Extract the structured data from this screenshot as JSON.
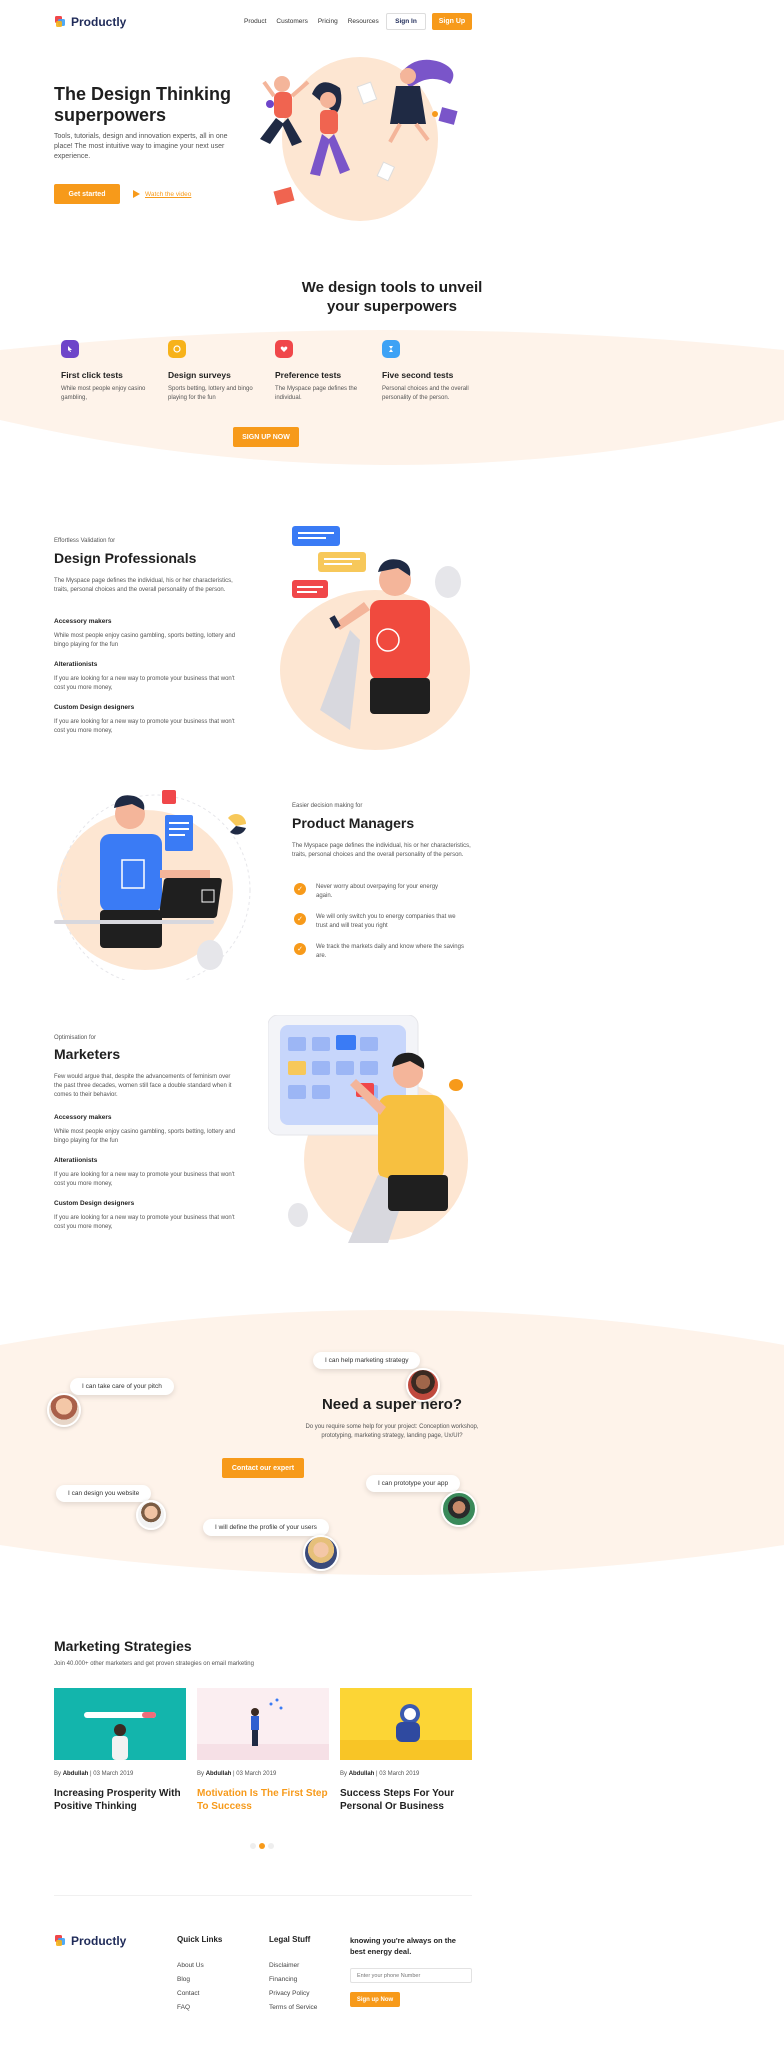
{
  "nav": {
    "brand": "Productly",
    "links": [
      "Product",
      "Customers",
      "Pricing",
      "Resources"
    ],
    "signin": "Sign In",
    "signup": "Sign Up"
  },
  "hero": {
    "title_line1": "The Design Thinking",
    "title_line2": "superpowers",
    "desc": "Tools, tutorials, design and innovation experts, all in one place! The most intuitive way to imagine your next user experience.",
    "cta": "Get started",
    "video": "Watch the video"
  },
  "tools": {
    "title_line1": "We design tools to unveil",
    "title_line2": "your superpowers",
    "features": [
      {
        "title": "First click tests",
        "desc": "While most people enjoy casino gambling,",
        "color": "#6e45c9"
      },
      {
        "title": "Design surveys",
        "desc": "Sports betting, lottery and bingo playing for the fun",
        "color": "#f7b21a"
      },
      {
        "title": "Preference tests",
        "desc": "The Myspace page defines the individual.",
        "color": "#f0474a"
      },
      {
        "title": "Five second tests",
        "desc": "Personal choices and the overall personality of the person.",
        "color": "#3ea2f5"
      }
    ],
    "cta": "SIGN UP NOW"
  },
  "designers": {
    "eyebrow": "Effortless Validation for",
    "title": "Design Professionals",
    "desc": "The Myspace page defines the individual, his or her characteristics, traits, personal choices and the overall personality of the person.",
    "items": [
      {
        "title": "Accessory makers",
        "desc": "While most people enjoy casino gambling, sports betting, lottery and bingo playing for the fun"
      },
      {
        "title": "Alteratiionists",
        "desc": "If you are looking for a new way to promote your business that won't cost you more money,"
      },
      {
        "title": "Custom Design designers",
        "desc": "If you are looking for a new way to promote your business that won't cost you more money,"
      }
    ]
  },
  "managers": {
    "eyebrow": "Easier decision making for",
    "title": "Product Managers",
    "desc": "The Myspace page defines the individual, his or her characteristics, traits, personal choices and the overall personality of the person.",
    "checks": [
      "Never worry about overpaying for your energy again.",
      "We will only switch you to energy companies that we trust and will treat you right",
      "We track the markets daily and know where the savings are."
    ]
  },
  "marketers": {
    "eyebrow": "Optimisation for",
    "title": "Marketers",
    "desc": "Few would argue that, despite the advancements of feminism over the past three decades, women still face a double standard when it comes to their behavior.",
    "items": [
      {
        "title": "Accessory makers",
        "desc": "While most people enjoy casino gambling, sports betting, lottery and bingo playing for the fun"
      },
      {
        "title": "Alteratiionists",
        "desc": "If you are looking for a new way to promote your business that won't cost you more money,"
      },
      {
        "title": "Custom Design designers",
        "desc": "If you are looking for a new way to promote your business that won't cost you more money,"
      }
    ]
  },
  "hero2": {
    "title": "Need a super hero?",
    "desc": "Do you require some help for your project: Conception workshop, prototyping, marketing strategy, landing page, Ux/UI?",
    "cta": "Contact our expert",
    "bubbles": [
      "I can take care of your pitch",
      "I can help marketing strategy",
      "I can design you website",
      "I can prototype your app",
      "I will define the profile of your users"
    ]
  },
  "blog": {
    "title": "Marketing Strategies",
    "subtitle": "Join 40.000+ other marketers and get proven strategies on email marketing",
    "posts": [
      {
        "by": "By",
        "author": "Abdullah",
        "date": "| 03 March 2019",
        "title": "Increasing Prosperity With Positive Thinking"
      },
      {
        "by": "By",
        "author": "Abdullah",
        "date": "| 03 March 2019",
        "title": "Motivation Is The First Step To Success"
      },
      {
        "by": "By",
        "author": "Abdullah",
        "date": "| 03 March 2019",
        "title": "Success Steps For Your Personal Or Business"
      }
    ]
  },
  "footer": {
    "brand": "Productly",
    "quick_title": "Quick Links",
    "quick": [
      "About Us",
      "Blog",
      "Contact",
      "FAQ"
    ],
    "legal_title": "Legal Stuff",
    "legal": [
      "Disclaimer",
      "Financing",
      "Privacy Policy",
      "Terms of Service"
    ],
    "news_title": "knowing you're always on the best energy deal.",
    "placeholder": "Enter your phone Number",
    "cta": "Sign up Now"
  },
  "colors": {
    "accent": "#f79a1a",
    "brand_dark": "#1f2b59",
    "peach": "#fde6d2"
  }
}
